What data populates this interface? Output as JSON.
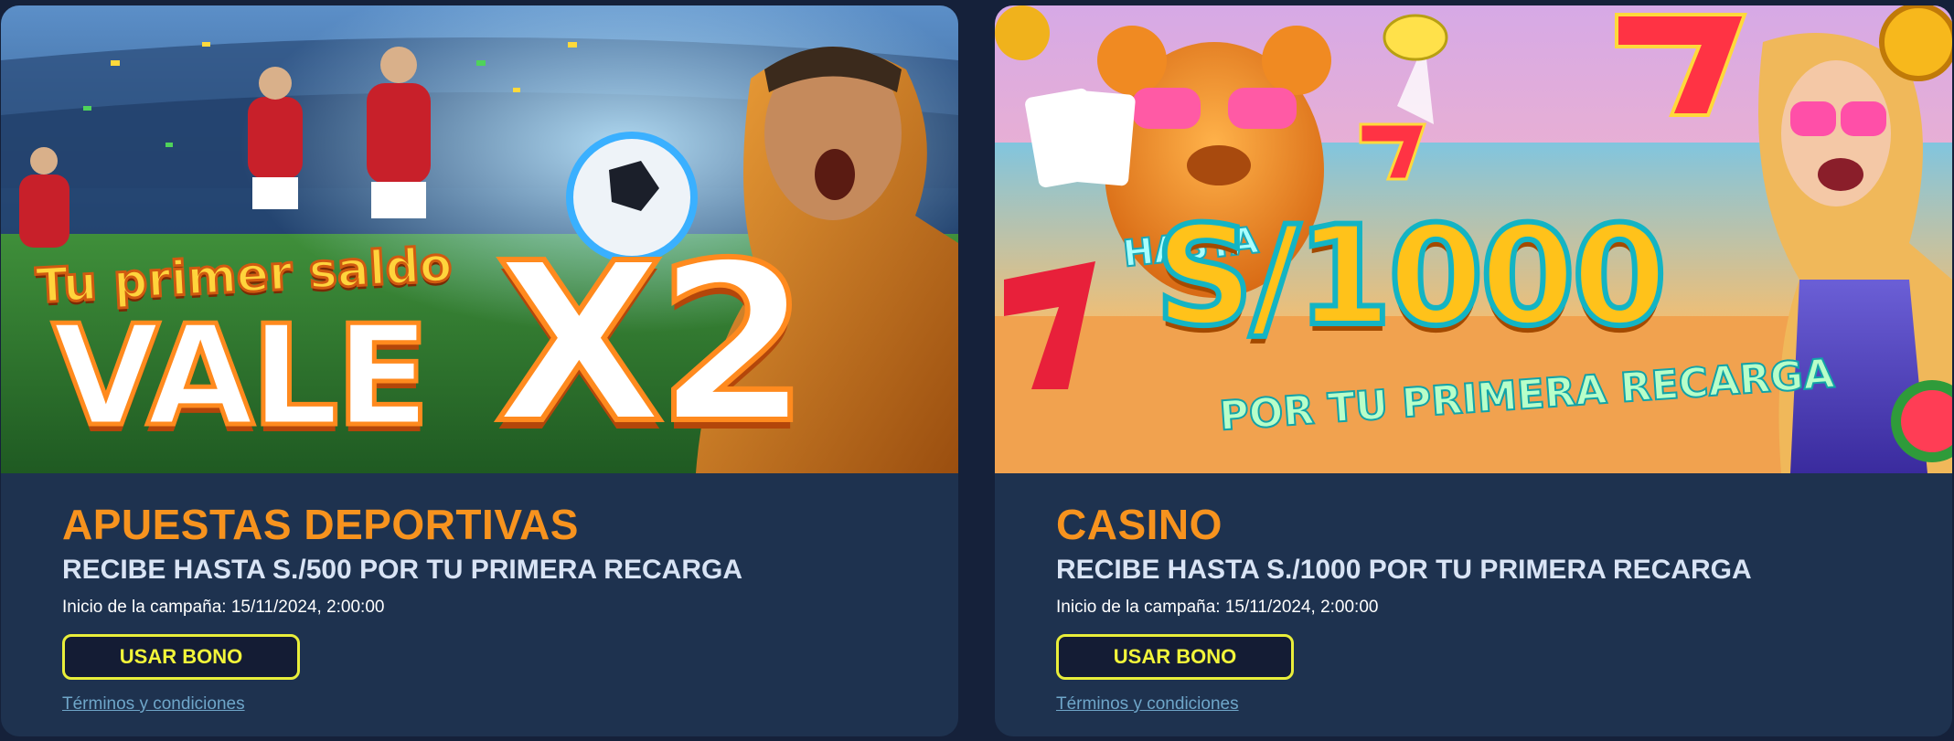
{
  "promos": [
    {
      "banner": {
        "line1": "Tu primer saldo",
        "line2": "VALE",
        "line3": "X2"
      },
      "category": "APUESTAS DEPORTIVAS",
      "headline": "RECIBE HASTA S./500 POR TU PRIMERA RECARGA",
      "start_date": "Inicio de la campaña: 15/11/2024, 2:00:00",
      "button_label": "USAR BONO",
      "terms_label": "Términos y condiciones"
    },
    {
      "banner": {
        "line1": "HASTA",
        "line2": "S/1000",
        "line3": "POR TU PRIMERA RECARGA"
      },
      "category": "CASINO",
      "headline": "RECIBE HASTA S./1000 POR TU PRIMERA RECARGA",
      "start_date": "Inicio de la campaña: 15/11/2024, 2:00:00",
      "button_label": "USAR BONO",
      "terms_label": "Términos y condiciones"
    }
  ],
  "colors": {
    "background": "#15213a",
    "card": "#1e324f",
    "category_title": "#f7931e",
    "button_border": "#e9ee3a",
    "link": "#6fa6c9"
  }
}
